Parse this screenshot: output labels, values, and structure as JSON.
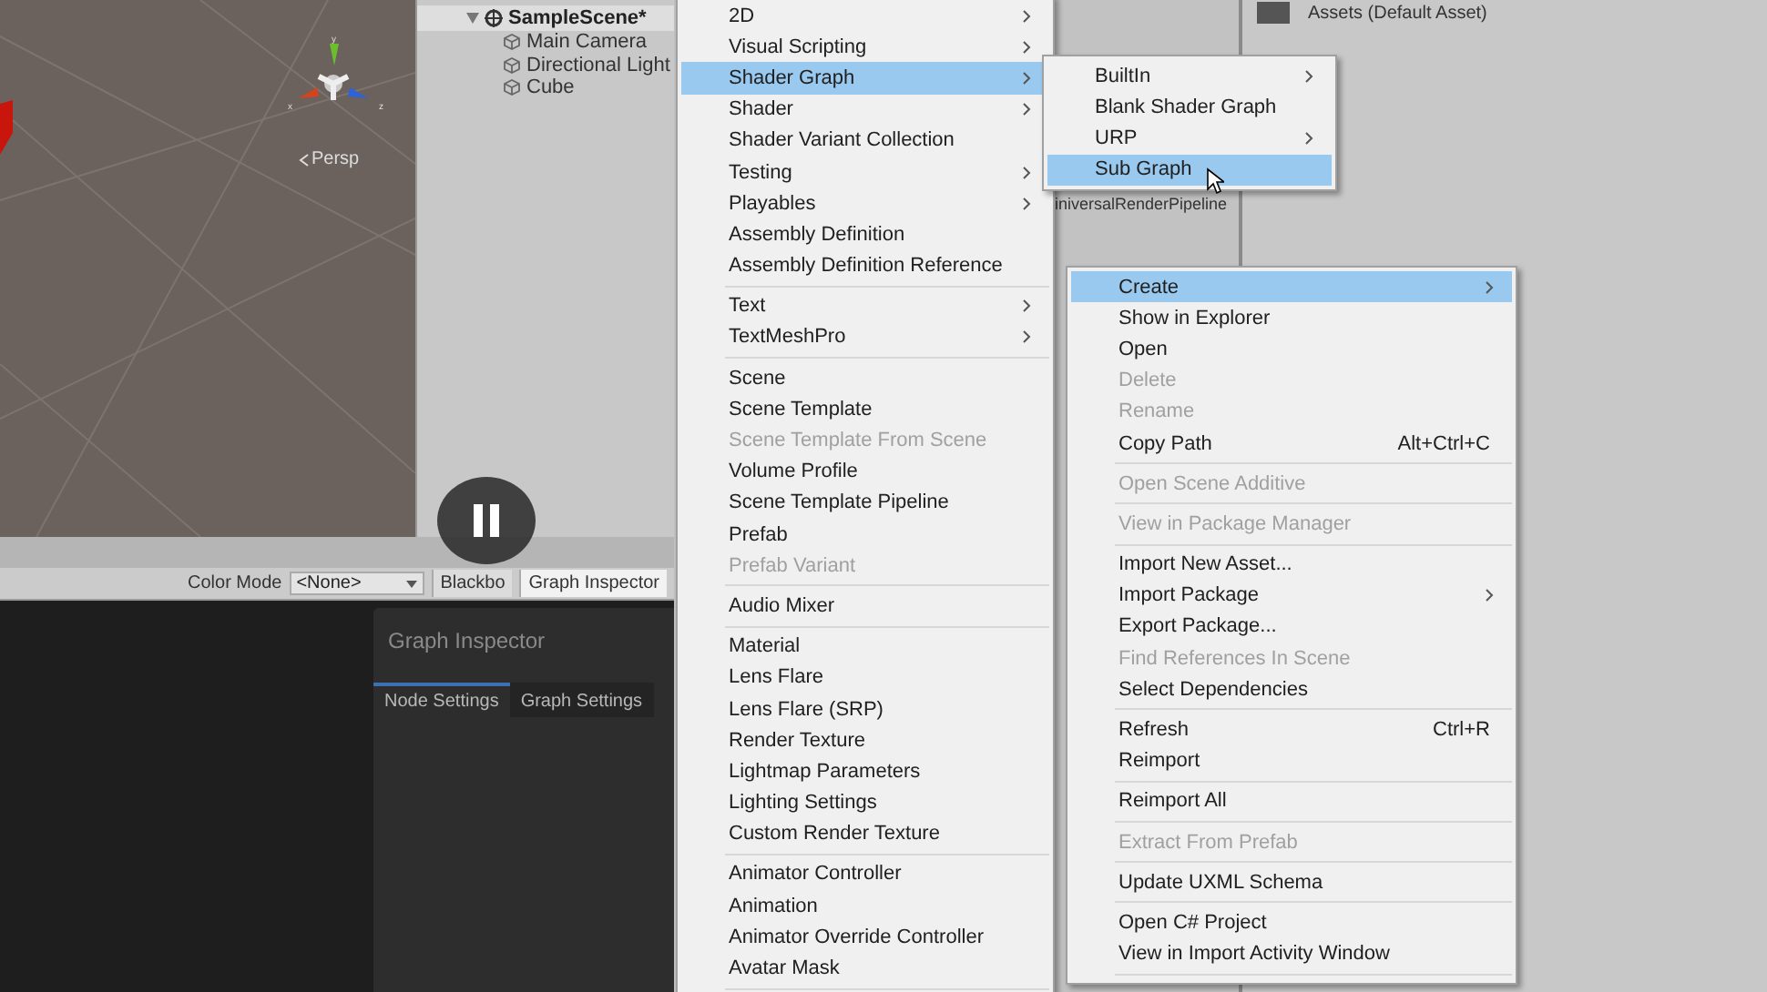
{
  "scene_view": {
    "persp_label": "Persp",
    "gizmo_axes": [
      "y",
      "x",
      "z"
    ]
  },
  "hierarchy": {
    "scene": {
      "name": "SampleScene*",
      "expanded": true,
      "children": [
        {
          "name": "Main Camera"
        },
        {
          "name": "Directional Light"
        },
        {
          "name": "Cube"
        }
      ]
    }
  },
  "graph_toolbar": {
    "color_mode_label": "Color Mode",
    "color_mode_value": "<None>",
    "buttons": [
      "Blackbo",
      "Graph Inspector"
    ]
  },
  "graph_inspector": {
    "title": "Graph Inspector",
    "tabs": [
      {
        "label": "Node Settings",
        "selected": true
      },
      {
        "label": "Graph Settings",
        "selected": false
      }
    ]
  },
  "project": {
    "asset_label": "iniversalRenderPipeline",
    "header": "Assets (Default Asset)"
  },
  "menus": [
    {
      "items": [
        {
          "kind": "item",
          "label": "2D",
          "submenu": true,
          "disabled": false,
          "selected": false
        },
        {
          "kind": "item",
          "label": "Visual Scripting",
          "submenu": true,
          "disabled": false,
          "selected": false
        },
        {
          "kind": "item",
          "label": "Shader Graph",
          "submenu": true,
          "disabled": false,
          "selected": true
        },
        {
          "kind": "item",
          "label": "Shader",
          "submenu": true,
          "disabled": false,
          "selected": false
        },
        {
          "kind": "item",
          "label": "Shader Variant Collection",
          "submenu": false,
          "disabled": false,
          "selected": false
        },
        {
          "kind": "item",
          "label": "Testing",
          "submenu": true,
          "disabled": false,
          "selected": false
        },
        {
          "kind": "item",
          "label": "Playables",
          "submenu": true,
          "disabled": false,
          "selected": false
        },
        {
          "kind": "item",
          "label": "Assembly Definition",
          "submenu": false,
          "disabled": false,
          "selected": false
        },
        {
          "kind": "item",
          "label": "Assembly Definition Reference",
          "submenu": false,
          "disabled": false,
          "selected": false
        },
        {
          "kind": "separator"
        },
        {
          "kind": "item",
          "label": "Text",
          "submenu": true,
          "disabled": false,
          "selected": false
        },
        {
          "kind": "item",
          "label": "TextMeshPro",
          "submenu": true,
          "disabled": false,
          "selected": false
        },
        {
          "kind": "separator"
        },
        {
          "kind": "item",
          "label": "Scene",
          "submenu": false,
          "disabled": false,
          "selected": false
        },
        {
          "kind": "item",
          "label": "Scene Template",
          "submenu": false,
          "disabled": false,
          "selected": false
        },
        {
          "kind": "item",
          "label": "Scene Template From Scene",
          "submenu": false,
          "disabled": true,
          "selected": false
        },
        {
          "kind": "item",
          "label": "Volume Profile",
          "submenu": false,
          "disabled": false,
          "selected": false
        },
        {
          "kind": "item",
          "label": "Scene Template Pipeline",
          "submenu": false,
          "disabled": false,
          "selected": false
        },
        {
          "kind": "item",
          "label": "Prefab",
          "submenu": false,
          "disabled": false,
          "selected": false
        },
        {
          "kind": "item",
          "label": "Prefab Variant",
          "submenu": false,
          "disabled": true,
          "selected": false
        },
        {
          "kind": "separator"
        },
        {
          "kind": "item",
          "label": "Audio Mixer",
          "submenu": false,
          "disabled": false,
          "selected": false
        },
        {
          "kind": "separator"
        },
        {
          "kind": "item",
          "label": "Material",
          "submenu": false,
          "disabled": false,
          "selected": false
        },
        {
          "kind": "item",
          "label": "Lens Flare",
          "submenu": false,
          "disabled": false,
          "selected": false
        },
        {
          "kind": "item",
          "label": "Lens Flare (SRP)",
          "submenu": false,
          "disabled": false,
          "selected": false
        },
        {
          "kind": "item",
          "label": "Render Texture",
          "submenu": false,
          "disabled": false,
          "selected": false
        },
        {
          "kind": "item",
          "label": "Lightmap Parameters",
          "submenu": false,
          "disabled": false,
          "selected": false
        },
        {
          "kind": "item",
          "label": "Lighting Settings",
          "submenu": false,
          "disabled": false,
          "selected": false
        },
        {
          "kind": "item",
          "label": "Custom Render Texture",
          "submenu": false,
          "disabled": false,
          "selected": false
        },
        {
          "kind": "separator"
        },
        {
          "kind": "item",
          "label": "Animator Controller",
          "submenu": false,
          "disabled": false,
          "selected": false
        },
        {
          "kind": "item",
          "label": "Animation",
          "submenu": false,
          "disabled": false,
          "selected": false
        },
        {
          "kind": "item",
          "label": "Animator Override Controller",
          "submenu": false,
          "disabled": false,
          "selected": false
        },
        {
          "kind": "item",
          "label": "Avatar Mask",
          "submenu": false,
          "disabled": false,
          "selected": false
        },
        {
          "kind": "separator"
        }
      ]
    },
    {
      "items": [
        {
          "kind": "item",
          "label": "BuiltIn",
          "submenu": true,
          "disabled": false,
          "selected": false
        },
        {
          "kind": "item",
          "label": "Blank Shader Graph",
          "submenu": false,
          "disabled": false,
          "selected": false
        },
        {
          "kind": "item",
          "label": "URP",
          "submenu": true,
          "disabled": false,
          "selected": false
        },
        {
          "kind": "item",
          "label": "Sub Graph",
          "submenu": false,
          "disabled": false,
          "selected": true
        }
      ]
    },
    {
      "items": [
        {
          "kind": "item",
          "label": "Create",
          "submenu": true,
          "disabled": false,
          "selected": true
        },
        {
          "kind": "item",
          "label": "Show in Explorer",
          "submenu": false,
          "disabled": false,
          "selected": false
        },
        {
          "kind": "item",
          "label": "Open",
          "submenu": false,
          "disabled": false,
          "selected": false
        },
        {
          "kind": "item",
          "label": "Delete",
          "submenu": false,
          "disabled": true,
          "selected": false
        },
        {
          "kind": "item",
          "label": "Rename",
          "submenu": false,
          "disabled": true,
          "selected": false
        },
        {
          "kind": "item",
          "label": "Copy Path",
          "shortcut": "Alt+Ctrl+C",
          "submenu": false,
          "disabled": false,
          "selected": false
        },
        {
          "kind": "separator"
        },
        {
          "kind": "item",
          "label": "Open Scene Additive",
          "submenu": false,
          "disabled": true,
          "selected": false
        },
        {
          "kind": "separator"
        },
        {
          "kind": "item",
          "label": "View in Package Manager",
          "submenu": false,
          "disabled": true,
          "selected": false
        },
        {
          "kind": "separator"
        },
        {
          "kind": "item",
          "label": "Import New Asset...",
          "submenu": false,
          "disabled": false,
          "selected": false
        },
        {
          "kind": "item",
          "label": "Import Package",
          "submenu": true,
          "disabled": false,
          "selected": false
        },
        {
          "kind": "item",
          "label": "Export Package...",
          "submenu": false,
          "disabled": false,
          "selected": false
        },
        {
          "kind": "item",
          "label": "Find References In Scene",
          "submenu": false,
          "disabled": true,
          "selected": false
        },
        {
          "kind": "item",
          "label": "Select Dependencies",
          "submenu": false,
          "disabled": false,
          "selected": false
        },
        {
          "kind": "separator"
        },
        {
          "kind": "item",
          "label": "Refresh",
          "shortcut": "Ctrl+R",
          "submenu": false,
          "disabled": false,
          "selected": false
        },
        {
          "kind": "item",
          "label": "Reimport",
          "submenu": false,
          "disabled": false,
          "selected": false
        },
        {
          "kind": "separator"
        },
        {
          "kind": "item",
          "label": "Reimport All",
          "submenu": false,
          "disabled": false,
          "selected": false
        },
        {
          "kind": "separator"
        },
        {
          "kind": "item",
          "label": "Extract From Prefab",
          "submenu": false,
          "disabled": true,
          "selected": false
        },
        {
          "kind": "separator"
        },
        {
          "kind": "item",
          "label": "Update UXML Schema",
          "submenu": false,
          "disabled": false,
          "selected": false
        },
        {
          "kind": "separator"
        },
        {
          "kind": "item",
          "label": "Open C# Project",
          "submenu": false,
          "disabled": false,
          "selected": false
        },
        {
          "kind": "item",
          "label": "View in Import Activity Window",
          "submenu": false,
          "disabled": false,
          "selected": false
        },
        {
          "kind": "separator"
        }
      ]
    }
  ]
}
